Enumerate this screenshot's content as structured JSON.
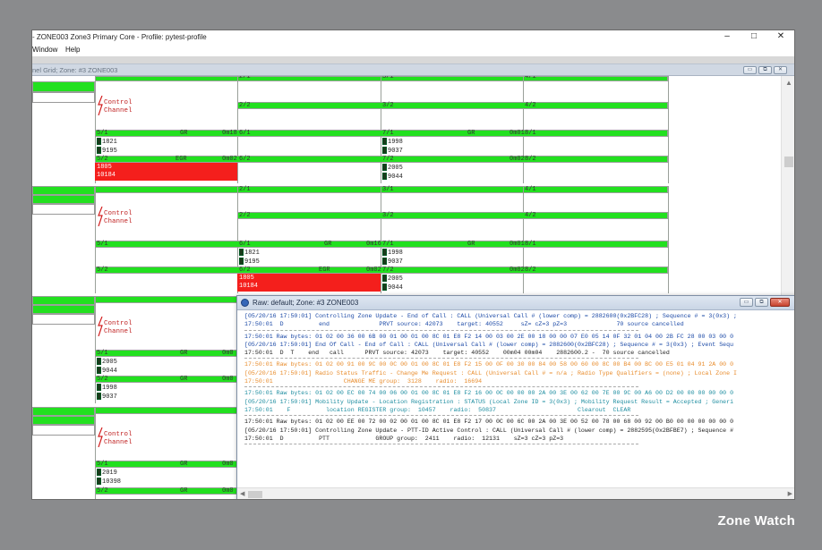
{
  "window": {
    "title": "- ZONE003 Zone3 Primary Core - Profile: pytest-profile",
    "minimize": "–",
    "maximize": "□",
    "close": "✕"
  },
  "menu": {
    "window": "Window",
    "help": "Help"
  },
  "mdi": {
    "title": "nel Grid; Zone: #3  ZONE003"
  },
  "grid": {
    "control_channel": "Control\nChannel",
    "cells": {
      "c31": "3/1",
      "c41": "4/1",
      "c22": "2/2",
      "c32": "3/2",
      "c42": "4/2",
      "c51": "5/1",
      "c61": "6/1",
      "c71": "7/1",
      "c81": "8/1",
      "c52": "5/2",
      "c62": "6/2",
      "c72": "7/2",
      "c82": "8/2",
      "c21": "2/1"
    },
    "gr": "GR",
    "egr": "EGR",
    "t0m18": "0m18",
    "t0m01": "0m01",
    "t0m02": "0m02",
    "t0m16": "0m16",
    "t0m0": "0m0",
    "ids": {
      "a": "1821",
      "b": "9195",
      "c": "1998",
      "d": "9037",
      "e": "1805",
      "f": "10184",
      "g": "2005",
      "h": "9044",
      "i": "2019",
      "j": "10398"
    }
  },
  "raw": {
    "title": "Raw: default; Zone: #3  ZONE003",
    "lines": [
      {
        "c": "blue",
        "t": "[05/20/16 17:50:01] Controlling Zone Update - End of Call : CALL (Universal Call # (lower comp) = 2882600(0x2BFC28) ; Sequence # = 3(0x3) ;"
      },
      {
        "c": "blue",
        "t": "17:50:01  D          end              PRVT source: 42073    target: 40552     sZ= cZ=3 pZ=3              70 source cancelled"
      },
      {
        "c": "div"
      },
      {
        "c": "blue",
        "t": "17:50:01 Raw bytes: 01 02 00 36 00 6B 00 01 00 01 00 8C 01 E8 F2 14 00 03 00 2E 00 18 00 00 07 E0 05 14 0F 32 01 04 00 2B FC 28 00 03 00 0"
      },
      {
        "c": "blue",
        "t": "[05/20/16 17:50:01] End Of Call - End of Call : CALL (Universal Call # (lower comp) = 2882600(0x2BFC28) ; Sequence # = 3(0x3) ; Event Sequ"
      },
      {
        "c": "dark",
        "t": "17:50:01  D  T    end   call      PRVT source: 42073    target: 40552    00m04 00m04    2882600.2 -  70 source cancelled"
      },
      {
        "c": "div"
      },
      {
        "c": "orange",
        "t": "17:50:01 Raw bytes: 01 02 00 91 00 9C 00 0C 00 01 00 8C 01 E8 F2 15 00 0F 00 30 00 84 00 58 00 60 00 8C 00 B4 00 BC 00 E5 01 04 91 2A 00 0"
      },
      {
        "c": "orange",
        "t": "[05/20/16 17:50:01] Radio Status Traffic - Change Me Request : CALL (Universal Call # = n/a ; Radio Type Qualifiers = (none) ; Local Zone I"
      },
      {
        "c": "orange",
        "t": "17:50:01                    CHANGE ME group:  3128    radio:  16694"
      },
      {
        "c": "div"
      },
      {
        "c": "teal",
        "t": "17:50:01 Raw bytes: 01 02 00 EC 00 74 00 06 00 01 00 8C 01 E8 F2 16 00 0C 00 00 00 2A 00 3E 00 62 00 7E 00 9C 00 A6 00 D2 00 00 00 00 00 0"
      },
      {
        "c": "teal",
        "t": "[05/20/16 17:50:01] Mobility Update - Location Registration : STATUS (Local Zone ID = 3(0x3) ; Mobility Request Result = Accepted ; Generi"
      },
      {
        "c": "teal",
        "t": "17:50:01    F          location REGISTER group:  10457    radio:  50837                       Clearout  CLEAR"
      },
      {
        "c": "div"
      },
      {
        "c": "dark",
        "t": "17:50:01 Raw bytes: 01 02 00 EE 00 72 00 02 00 01 00 8C 01 E8 F2 17 00 0C 00 6C 00 2A 00 3E 00 52 00 78 00 68 00 92 00 B0 00 00 00 00 00 0"
      },
      {
        "c": "dark",
        "t": "[05/20/16 17:50:01] Controlling Zone Update - PTT-ID Active Control : CALL (Universal Call # (lower comp) = 2882595(0x2BFBE7) ; Sequence #"
      },
      {
        "c": "dark",
        "t": "17:50:01  D          PTT             GROUP group:  2411    radio:  12131    sZ=3 cZ=3 pZ=3"
      },
      {
        "c": "div"
      }
    ]
  },
  "brand": "Zone Watch",
  "colors": {
    "green": "#22e01f",
    "red": "#f41f1c",
    "background": "#8a8b8d"
  }
}
